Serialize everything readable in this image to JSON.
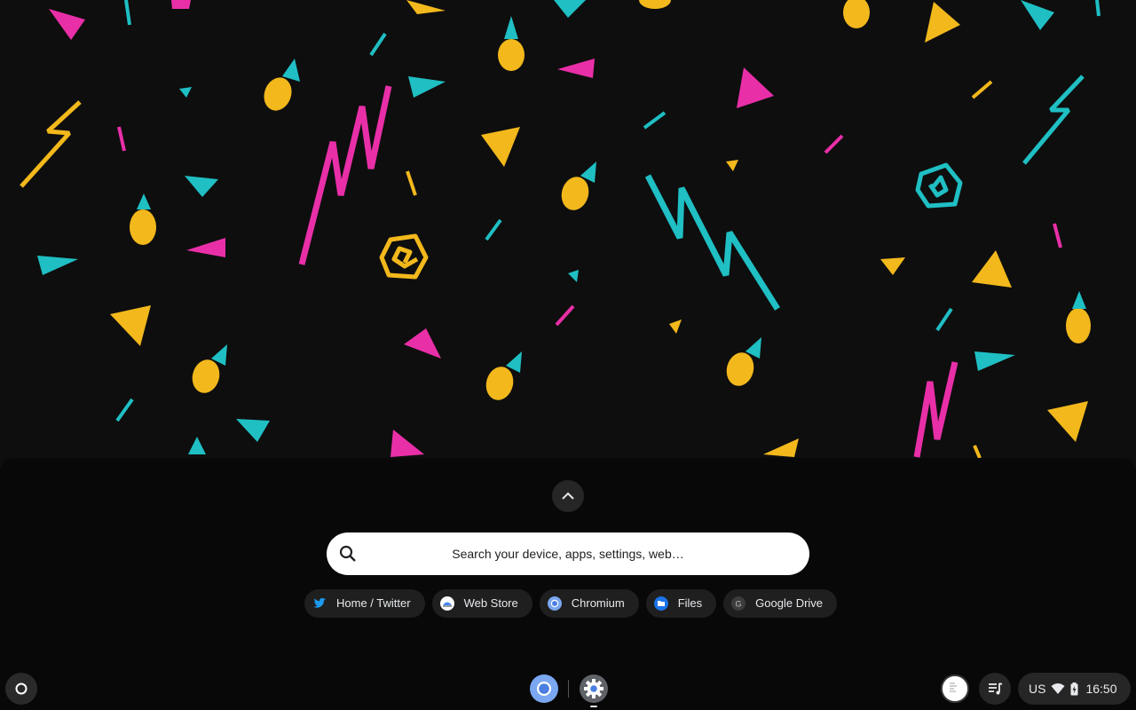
{
  "launcher": {
    "expand_icon": "chevron-up-icon",
    "search": {
      "icon": "search-icon",
      "placeholder": "Search your device, apps, settings, web…"
    },
    "suggestion_chips": [
      {
        "label": "Home / Twitter",
        "icon": "twitter-icon"
      },
      {
        "label": "Web Store",
        "icon": "web-store-icon"
      },
      {
        "label": "Chromium",
        "icon": "chromium-icon"
      },
      {
        "label": "Files",
        "icon": "files-icon"
      },
      {
        "label": "Google Drive",
        "icon": "google-drive-icon"
      }
    ]
  },
  "shelf": {
    "launcher_icon": "circle-launcher-icon",
    "pinned_apps": [
      {
        "name": "Chromium",
        "icon": "chromium-icon"
      },
      {
        "name": "Settings",
        "icon": "settings-gear-icon",
        "running": true
      }
    ]
  },
  "status_area": {
    "ime": "US",
    "wifi_icon": "wifi-icon",
    "battery_icon": "battery-charging-icon",
    "time": "16:50"
  },
  "colors": {
    "wallpaper_bg": "#0e0e0e",
    "pink": "#e92fa8",
    "yellow": "#f2b81c",
    "cyan": "#1fbfc4",
    "chip_bg": "#1f1f1f",
    "search_bg": "#ffffff"
  }
}
